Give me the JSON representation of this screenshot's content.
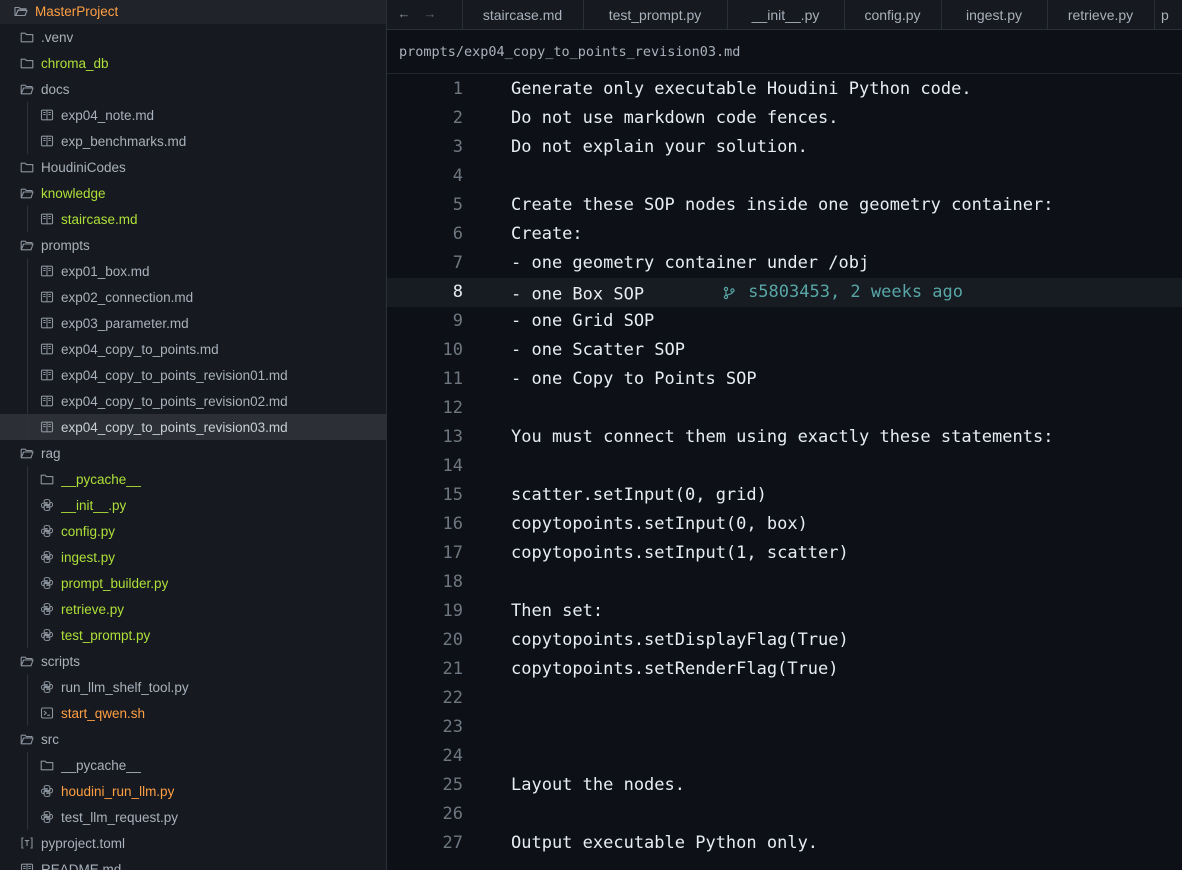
{
  "colors": {
    "accent_orange": "#ff9f43",
    "accent_green": "#aee03a",
    "blame": "#58a6a6"
  },
  "explorer": {
    "root": "MasterProject",
    "items": [
      {
        "label": ".venv",
        "icon": "folder-icon"
      },
      {
        "label": "chroma_db",
        "icon": "folder-icon"
      },
      {
        "label": "docs",
        "icon": "folder-open-icon"
      },
      {
        "label": "exp04_note.md",
        "icon": "book-icon"
      },
      {
        "label": "exp_benchmarks.md",
        "icon": "book-icon"
      },
      {
        "label": "HoudiniCodes",
        "icon": "folder-icon"
      },
      {
        "label": "knowledge",
        "icon": "folder-open-icon"
      },
      {
        "label": "staircase.md",
        "icon": "book-icon"
      },
      {
        "label": "prompts",
        "icon": "folder-open-icon"
      },
      {
        "label": "exp01_box.md",
        "icon": "book-icon"
      },
      {
        "label": "exp02_connection.md",
        "icon": "book-icon"
      },
      {
        "label": "exp03_parameter.md",
        "icon": "book-icon"
      },
      {
        "label": "exp04_copy_to_points.md",
        "icon": "book-icon"
      },
      {
        "label": "exp04_copy_to_points_revision01.md",
        "icon": "book-icon"
      },
      {
        "label": "exp04_copy_to_points_revision02.md",
        "icon": "book-icon"
      },
      {
        "label": "exp04_copy_to_points_revision03.md",
        "icon": "book-icon"
      },
      {
        "label": "rag",
        "icon": "folder-open-icon"
      },
      {
        "label": "__pycache__",
        "icon": "folder-icon"
      },
      {
        "label": "__init__.py",
        "icon": "python-icon"
      },
      {
        "label": "config.py",
        "icon": "python-icon"
      },
      {
        "label": "ingest.py",
        "icon": "python-icon"
      },
      {
        "label": "prompt_builder.py",
        "icon": "python-icon"
      },
      {
        "label": "retrieve.py",
        "icon": "python-icon"
      },
      {
        "label": "test_prompt.py",
        "icon": "python-icon"
      },
      {
        "label": "scripts",
        "icon": "folder-open-icon"
      },
      {
        "label": "run_llm_shelf_tool.py",
        "icon": "python-icon"
      },
      {
        "label": "start_qwen.sh",
        "icon": "terminal-icon"
      },
      {
        "label": "src",
        "icon": "folder-open-icon"
      },
      {
        "label": "__pycache__",
        "icon": "folder-icon"
      },
      {
        "label": "houdini_run_llm.py",
        "icon": "python-icon"
      },
      {
        "label": "test_llm_request.py",
        "icon": "python-icon"
      },
      {
        "label": "pyproject.toml",
        "icon": "toml-icon"
      },
      {
        "label": "README.md",
        "icon": "book-icon"
      }
    ]
  },
  "tabs": [
    "staircase.md",
    "test_prompt.py",
    "__init__.py",
    "config.py",
    "ingest.py",
    "retrieve.py",
    "p"
  ],
  "breadcrumb": "prompts/exp04_copy_to_points_revision03.md",
  "editor": {
    "active_line": 8,
    "blame": "s5803453, 2 weeks ago",
    "lines": [
      "Generate only executable Houdini Python code.",
      "Do not use markdown code fences.",
      "Do not explain your solution.",
      "",
      "Create these SOP nodes inside one geometry container:",
      "Create:",
      "- one geometry container under /obj",
      "- one Box SOP",
      "- one Grid SOP",
      "- one Scatter SOP",
      "- one Copy to Points SOP",
      "",
      "You must connect them using exactly these statements:",
      "",
      "scatter.setInput(0, grid)",
      "copytopoints.setInput(0, box)",
      "copytopoints.setInput(1, scatter)",
      "",
      "Then set:",
      "copytopoints.setDisplayFlag(True)",
      "copytopoints.setRenderFlag(True)",
      "",
      "",
      "",
      "Layout the nodes.",
      "",
      "Output executable Python only."
    ]
  }
}
